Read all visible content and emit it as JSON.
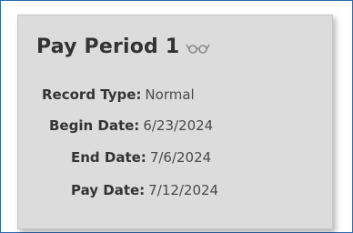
{
  "card": {
    "title": "Pay Period 1",
    "title_icon": "glasses-icon",
    "fields": [
      {
        "label": "Record Type:",
        "value": "Normal"
      },
      {
        "label": "Begin Date:",
        "value": "6/23/2024"
      },
      {
        "label": "End Date:",
        "value": "7/6/2024"
      },
      {
        "label": "Pay Date:",
        "value": "7/12/2024"
      }
    ]
  },
  "colors": {
    "frame_border": "#2f6bb0",
    "card_bg": "#dcdcdc",
    "label_text": "#333333",
    "value_text": "#4a4a4a"
  }
}
